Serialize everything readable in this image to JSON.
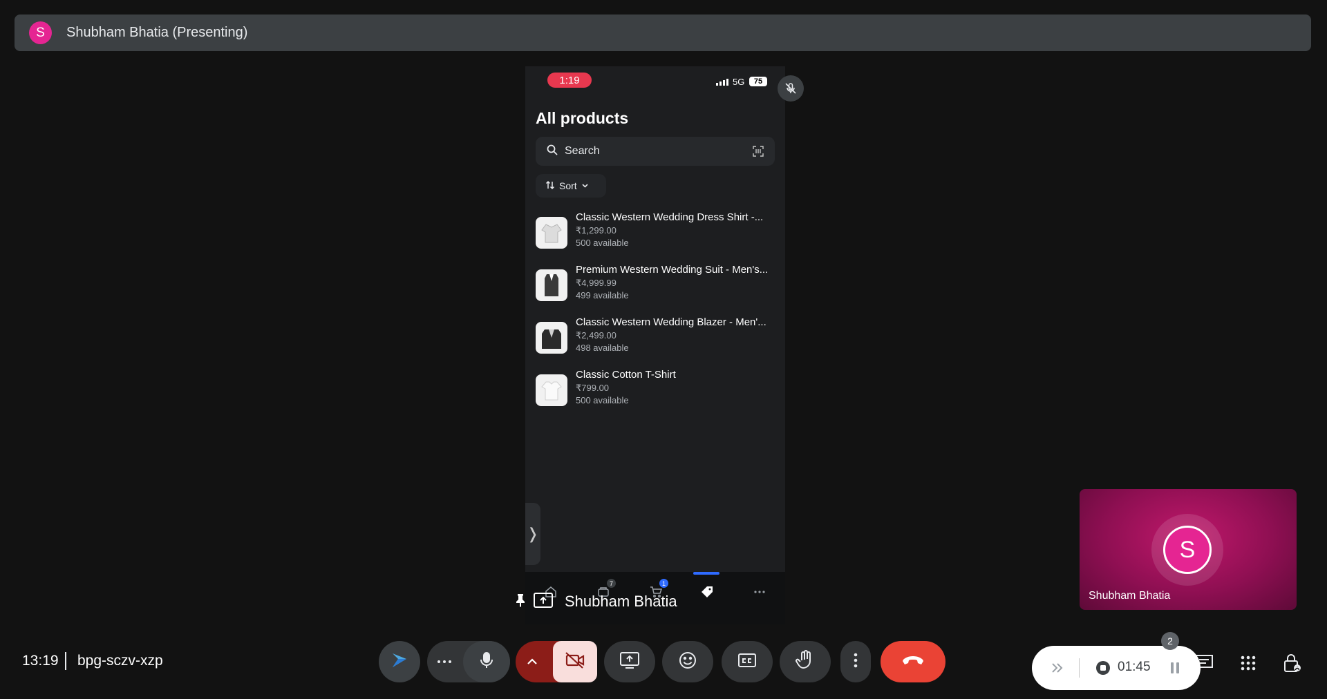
{
  "presenter_bar": {
    "avatar_letter": "S",
    "title": "Shubham Bhatia (Presenting)"
  },
  "phone": {
    "time": "1:19",
    "network": "5G",
    "battery": "75",
    "heading": "All products",
    "search_placeholder": "Search",
    "sort_label": "Sort",
    "products": [
      {
        "name": "Classic Western Wedding Dress Shirt -...",
        "price": "₹1,299.00",
        "availability": "500 available",
        "thumb": "shirt"
      },
      {
        "name": "Premium Western Wedding Suit - Men's...",
        "price": "₹4,999.99",
        "availability": "499 available",
        "thumb": "suit"
      },
      {
        "name": "Classic Western Wedding Blazer - Men'...",
        "price": "₹2,499.00",
        "availability": "498 available",
        "thumb": "blazer"
      },
      {
        "name": "Classic Cotton T-Shirt",
        "price": "₹799.00",
        "availability": "500 available",
        "thumb": "tshirt"
      }
    ],
    "side_handle": "❭",
    "tabs": [
      {
        "icon": "home-icon",
        "badge": ""
      },
      {
        "icon": "orders-icon",
        "badge": "7"
      },
      {
        "icon": "cart-icon",
        "badge": "1"
      },
      {
        "icon": "tag-icon",
        "badge": ""
      },
      {
        "icon": "more-icon",
        "badge": ""
      }
    ]
  },
  "presenter_tile": {
    "name": "Shubham Bhatia"
  },
  "self_tile": {
    "avatar_letter": "S",
    "name": "Shubham Bhatia"
  },
  "meeting": {
    "time": "13:19",
    "code": "bpg-sczv-xzp"
  },
  "recording": {
    "participant_count": "2",
    "elapsed": "01:45"
  },
  "colors": {
    "accent_pink": "#e52592",
    "end_call_red": "#ea4335",
    "camera_off_bg": "#f9dedc",
    "phone_time_pill": "#e8384f",
    "badge_blue": "#2f6bff"
  }
}
